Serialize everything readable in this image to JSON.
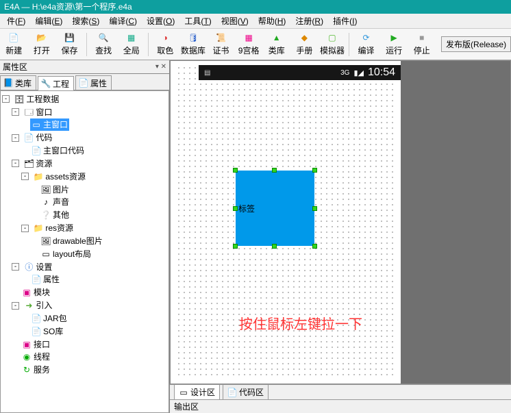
{
  "title": "E4A — H:\\e4a资源\\第一个程序.e4a",
  "menu": [
    {
      "label": "件",
      "m": "F"
    },
    {
      "label": "编辑",
      "m": "E"
    },
    {
      "label": "搜索",
      "m": "S"
    },
    {
      "label": "编译",
      "m": "C"
    },
    {
      "label": "设置",
      "m": "O"
    },
    {
      "label": "工具",
      "m": "T"
    },
    {
      "label": "视图",
      "m": "V"
    },
    {
      "label": "帮助",
      "m": "H"
    },
    {
      "label": "注册",
      "m": "R"
    },
    {
      "label": "插件",
      "m": "I"
    }
  ],
  "toolbar": [
    {
      "name": "new",
      "label": "新建",
      "icon": "📄",
      "color": "#e6b800"
    },
    {
      "name": "open",
      "label": "打开",
      "icon": "📂",
      "color": "#e6b800"
    },
    {
      "name": "save",
      "label": "保存",
      "icon": "💾",
      "color": "#2b7de9"
    },
    {
      "sep": true
    },
    {
      "name": "find",
      "label": "查找",
      "icon": "🔍",
      "color": "#333"
    },
    {
      "name": "global",
      "label": "全局",
      "icon": "▦",
      "color": "#1a8"
    },
    {
      "sep": true
    },
    {
      "name": "color",
      "label": "取色",
      "icon": "◑",
      "color": "#d33"
    },
    {
      "name": "database",
      "label": "数据库",
      "icon": "🛢",
      "color": "#36c"
    },
    {
      "name": "cert",
      "label": "证书",
      "icon": "📜",
      "color": "#b66"
    },
    {
      "name": "nine",
      "label": "9宫格",
      "icon": "▦",
      "color": "#e08"
    },
    {
      "name": "classes",
      "label": "类库",
      "icon": "▲",
      "color": "#2a2"
    },
    {
      "name": "manual",
      "label": "手册",
      "icon": "◆",
      "color": "#d80"
    },
    {
      "name": "emulator",
      "label": "模拟器",
      "icon": "▢",
      "color": "#5b3"
    },
    {
      "sep": true
    },
    {
      "name": "compile",
      "label": "编译",
      "icon": "⟳",
      "color": "#39d"
    },
    {
      "name": "run",
      "label": "运行",
      "icon": "▶",
      "color": "#2a2"
    },
    {
      "name": "stop",
      "label": "停止",
      "icon": "■",
      "color": "#999"
    }
  ],
  "release_button": "发布版(Release)",
  "left_panel": {
    "header": "属性区",
    "tabs": [
      {
        "label": "类库",
        "icon": "📘"
      },
      {
        "label": "工程",
        "icon": "🔧",
        "active": true
      },
      {
        "label": "属性",
        "icon": "📄"
      }
    ],
    "tree": {
      "root": "工程数据",
      "window": "窗口",
      "main_window": "主窗口",
      "code": "代码",
      "main_window_code": "主窗口代码",
      "resources": "资源",
      "assets": "assets资源",
      "image": "图片",
      "sound": "声音",
      "other": "其他",
      "res": "res资源",
      "drawable": "drawable图片",
      "layout": "layout布局",
      "settings": "设置",
      "props": "属性",
      "modules": "模块",
      "import": "引入",
      "jar": "JAR包",
      "so": "SO库",
      "interface": "接口",
      "thread": "线程",
      "service": "服务"
    }
  },
  "designer": {
    "status_left": "▤",
    "status_3g": "3G",
    "status_sig": "▮◢",
    "status_time": "10:54",
    "widget_label": "标签",
    "tip": "按住鼠标左键拉一下",
    "tab_design": "设计区",
    "tab_code": "代码区",
    "output": "输出区"
  }
}
